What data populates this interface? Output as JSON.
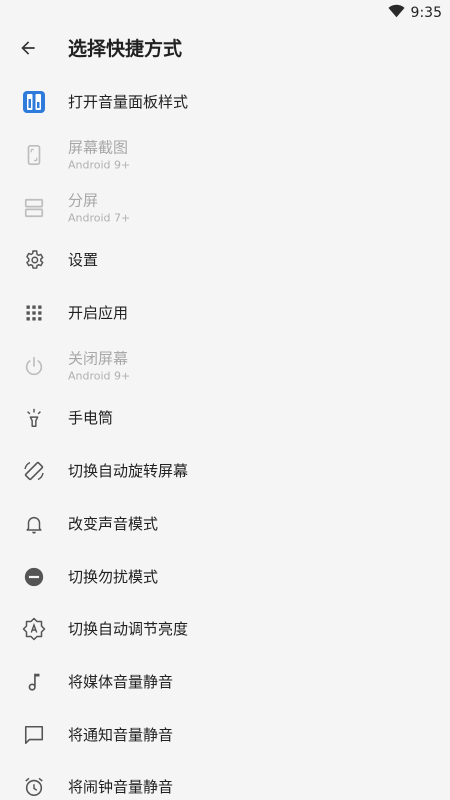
{
  "status_bar": {
    "time": "9:35",
    "wifi_icon": "wifi-icon"
  },
  "header": {
    "title": "选择快捷方式",
    "back_icon": "arrow-back-icon"
  },
  "items": [
    {
      "label": "打开音量面板样式",
      "sub": "",
      "enabled": true,
      "icon": "volume-panel-icon"
    },
    {
      "label": "屏幕截图",
      "sub": "Android 9+",
      "enabled": false,
      "icon": "screenshot-icon"
    },
    {
      "label": "分屏",
      "sub": "Android 7+",
      "enabled": false,
      "icon": "split-screen-icon"
    },
    {
      "label": "设置",
      "sub": "",
      "enabled": true,
      "icon": "gear-icon"
    },
    {
      "label": "开启应用",
      "sub": "",
      "enabled": true,
      "icon": "apps-grid-icon"
    },
    {
      "label": "关闭屏幕",
      "sub": "Android 9+",
      "enabled": false,
      "icon": "power-icon"
    },
    {
      "label": "手电筒",
      "sub": "",
      "enabled": true,
      "icon": "flashlight-icon"
    },
    {
      "label": "切换自动旋转屏幕",
      "sub": "",
      "enabled": true,
      "icon": "screen-rotation-icon"
    },
    {
      "label": "改变声音模式",
      "sub": "",
      "enabled": true,
      "icon": "bell-icon"
    },
    {
      "label": "切换勿扰模式",
      "sub": "",
      "enabled": true,
      "icon": "do-not-disturb-icon"
    },
    {
      "label": "切换自动调节亮度",
      "sub": "",
      "enabled": true,
      "icon": "brightness-auto-icon"
    },
    {
      "label": "将媒体音量静音",
      "sub": "",
      "enabled": true,
      "icon": "music-note-icon"
    },
    {
      "label": "将通知音量静音",
      "sub": "",
      "enabled": true,
      "icon": "message-icon"
    },
    {
      "label": "将闹钟音量静音",
      "sub": "",
      "enabled": true,
      "icon": "alarm-icon"
    }
  ],
  "colors": {
    "accent": "#2f7bdc",
    "icon": "#555555",
    "icon_disabled": "#bdbdbd",
    "background": "#f5f5f5"
  }
}
